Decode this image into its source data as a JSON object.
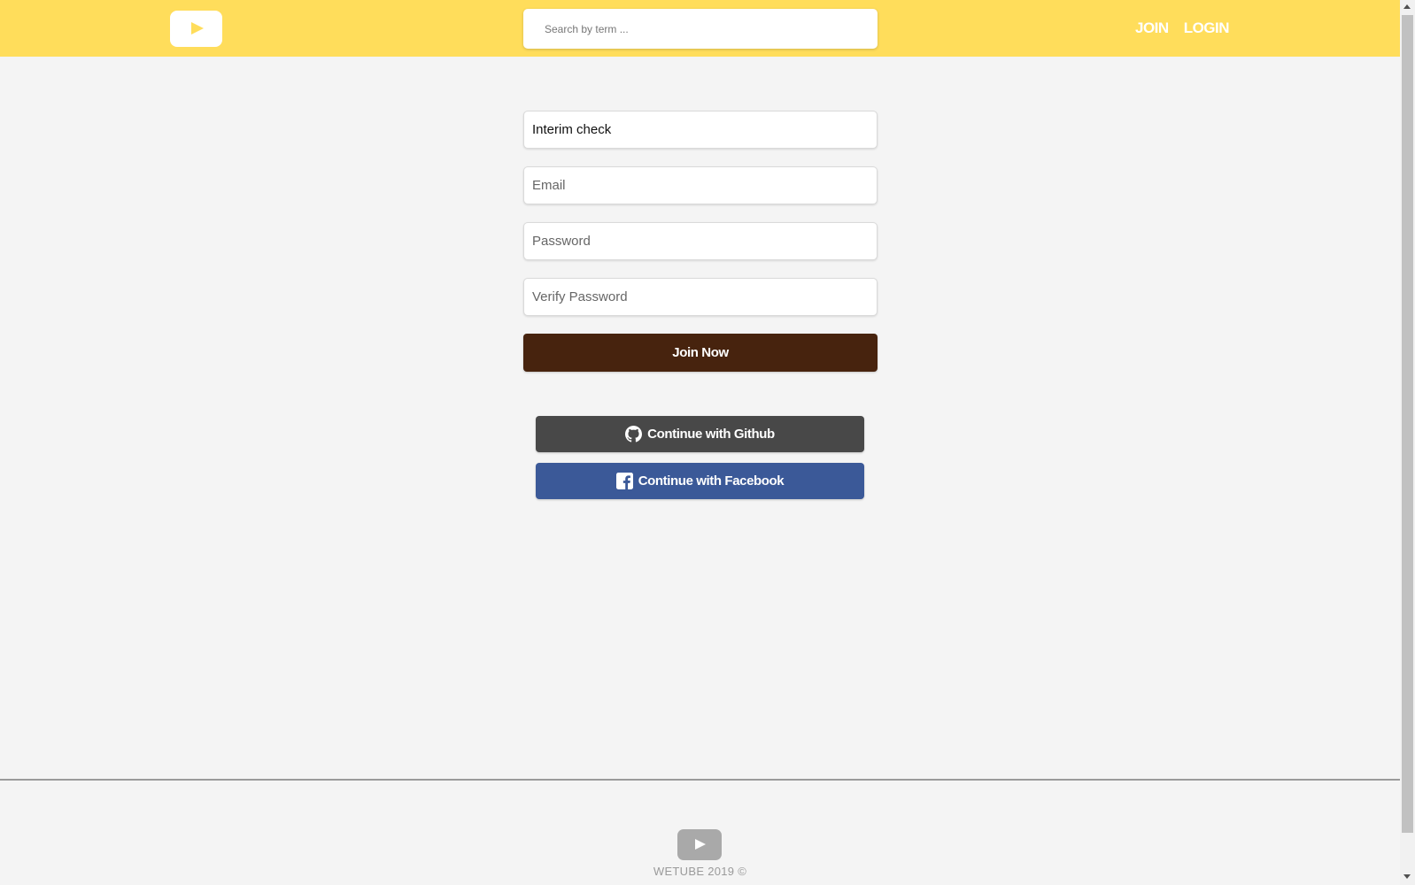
{
  "header": {
    "search_placeholder": "Search by term ...",
    "nav": {
      "join": "JOIN",
      "login": "LOGIN"
    },
    "background_color": "#ffdd5b"
  },
  "form": {
    "name_value": "Interim check",
    "email_placeholder": "Email",
    "password_placeholder": "Password",
    "verify_password_placeholder": "Verify Password",
    "submit_label": "Join Now",
    "submit_color": "#47230e"
  },
  "social": {
    "github_label": "Continue with Github",
    "github_icon": "github-icon",
    "github_color": "#484848",
    "facebook_label": "Continue with Facebook",
    "facebook_icon": "facebook-icon",
    "facebook_color": "#3b5998"
  },
  "footer": {
    "copyright": "WETUBE 2019 ©"
  }
}
